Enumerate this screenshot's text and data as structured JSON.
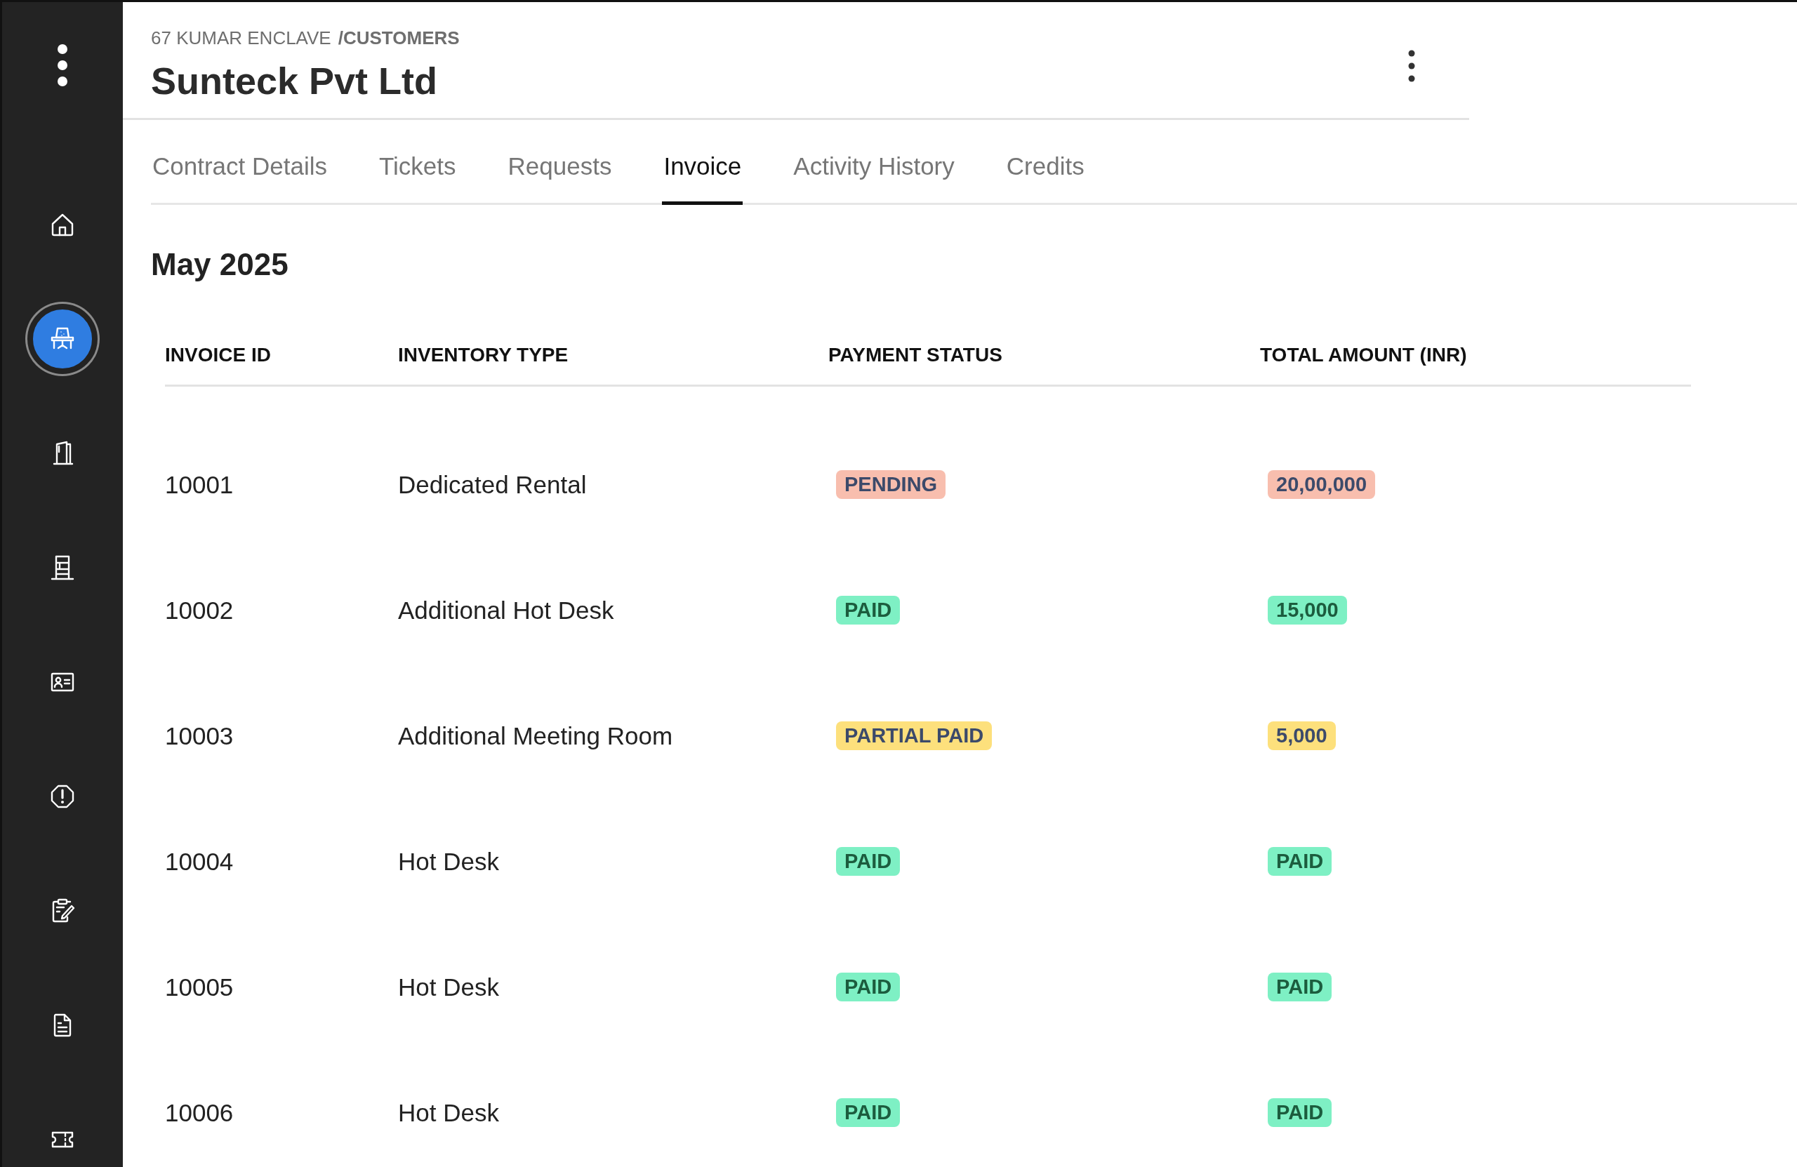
{
  "sidebar": {
    "items": [
      {
        "selected": false
      },
      {
        "selected": true
      },
      {
        "selected": false
      },
      {
        "selected": false
      },
      {
        "selected": false
      },
      {
        "selected": false
      },
      {
        "selected": false
      },
      {
        "selected": false
      },
      {
        "selected": false
      }
    ]
  },
  "header": {
    "breadcrumb": {
      "location": "67 KUMAR ENCLAVE",
      "section": "/CUSTOMERS"
    },
    "title": "Sunteck Pvt Ltd"
  },
  "tabs": [
    {
      "label": "Contract Details",
      "selected": false
    },
    {
      "label": "Tickets",
      "selected": false
    },
    {
      "label": "Requests",
      "selected": false
    },
    {
      "label": "Invoice",
      "selected": true
    },
    {
      "label": "Activity History",
      "selected": false
    },
    {
      "label": "Credits",
      "selected": false
    }
  ],
  "period": "May 2025",
  "table": {
    "columns": [
      "INVOICE ID",
      "INVENTORY TYPE",
      "PAYMENT STATUS",
      "TOTAL AMOUNT (INR)"
    ],
    "rows": [
      {
        "invoice_id": "10001",
        "inventory_type": "Dedicated Rental",
        "payment_status": {
          "text": "PENDING",
          "kind": "pending"
        },
        "total_amount": {
          "text": "20,00,000",
          "kind": "pending"
        }
      },
      {
        "invoice_id": "10002",
        "inventory_type": "Additional Hot Desk",
        "payment_status": {
          "text": "PAID",
          "kind": "paid"
        },
        "total_amount": {
          "text": "15,000",
          "kind": "paid"
        }
      },
      {
        "invoice_id": "10003",
        "inventory_type": "Additional Meeting Room",
        "payment_status": {
          "text": "PARTIAL PAID",
          "kind": "partial"
        },
        "total_amount": {
          "text": "5,000",
          "kind": "partial"
        }
      },
      {
        "invoice_id": "10004",
        "inventory_type": "Hot Desk",
        "payment_status": {
          "text": "PAID",
          "kind": "paid"
        },
        "total_amount": {
          "text": "PAID",
          "kind": "paid"
        }
      },
      {
        "invoice_id": "10005",
        "inventory_type": "Hot Desk",
        "payment_status": {
          "text": "PAID",
          "kind": "paid"
        },
        "total_amount": {
          "text": "PAID",
          "kind": "paid"
        }
      },
      {
        "invoice_id": "10006",
        "inventory_type": "Hot Desk",
        "payment_status": {
          "text": "PAID",
          "kind": "paid"
        },
        "total_amount": {
          "text": "PAID",
          "kind": "paid"
        }
      }
    ]
  }
}
